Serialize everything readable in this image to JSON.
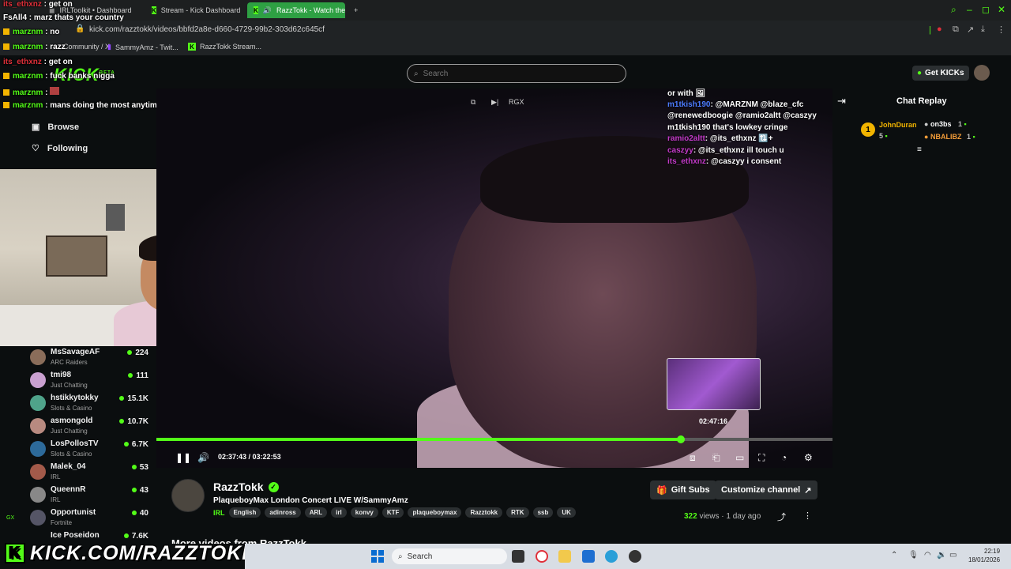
{
  "browser": {
    "tabs": [
      {
        "label": "IRLToolkit • Dashboard"
      },
      {
        "label": "Stream - Kick Dashboard"
      },
      {
        "label": "RazzTokk - Watch the"
      }
    ],
    "new_tab": "+",
    "url": "kick.com/razztokk/videos/bbfd2a8e-d660-4729-99b2-303d62c645cf",
    "bookmarks": [
      {
        "label": "Community / X"
      },
      {
        "label": "SammyAmz - Twit..."
      },
      {
        "label": "RazzTokk Stream..."
      }
    ]
  },
  "header": {
    "logo": "KICK",
    "logo_beta": "BETA",
    "search_placeholder": "Search",
    "get_kicks": "Get KICKs"
  },
  "nav": {
    "browse": "Browse",
    "following": "Following"
  },
  "overlay_chat": [
    {
      "user": "its_ethxnz",
      "sep": " : ",
      "msg": "get on",
      "color": "red"
    },
    {
      "user": "FsAll4",
      "sep": " : ",
      "msg": "marz thats your country",
      "color": "white"
    },
    {
      "user": "marznm",
      "sep": " : ",
      "msg": "no",
      "color": "green"
    },
    {
      "user": "marznm",
      "sep": " : ",
      "msg": "razz",
      "color": "green"
    },
    {
      "user": "its_ethxnz",
      "sep": " : ",
      "msg": "get on",
      "color": "red"
    },
    {
      "user": "marznm",
      "sep": " : ",
      "msg": "fuck banks nigga",
      "color": "green"
    },
    {
      "user": "marznm",
      "sep": " : ",
      "msg": "",
      "color": "green"
    },
    {
      "user": "marznm",
      "sep": " : ",
      "msg": "mans doing the most anytime that camera panned on you🤣🤣🤣",
      "color": "green"
    }
  ],
  "following_list": [
    {
      "name": "MsSavageAF",
      "category": "ARC Raiders",
      "viewers": "224"
    },
    {
      "name": "tmi98",
      "category": "Just Chatting",
      "viewers": "111"
    },
    {
      "name": "hstikkytokky",
      "category": "Slots & Casino",
      "viewers": "15.1K"
    },
    {
      "name": "asmongold",
      "category": "Just Chatting",
      "viewers": "10.7K"
    },
    {
      "name": "LosPollosTV",
      "category": "Slots & Casino",
      "viewers": "6.7K"
    },
    {
      "name": "Malek_04",
      "category": "IRL",
      "viewers": "53"
    },
    {
      "name": "QueennR",
      "category": "IRL",
      "viewers": "43"
    },
    {
      "name": "Opportunist",
      "category": "Fortnite",
      "viewers": "40"
    },
    {
      "name": "Ice Poseidon",
      "category": "",
      "viewers": "7.6K"
    }
  ],
  "video_chat": [
    {
      "user": "",
      "msg": "or with 🖼",
      "color": "n"
    },
    {
      "user": "m1tkish190",
      "msg": ": @MARZNM @blaze_cfc",
      "color": "b"
    },
    {
      "user": "",
      "msg": "@renewedboogie @ramio2altt @caszyy",
      "color": "n"
    },
    {
      "user": "",
      "msg": "m1tkish190 that's lowkey cringe",
      "color": "n"
    },
    {
      "user": "ramio2altt",
      "msg": ": @its_ethxnz 🔃+",
      "color": "p"
    },
    {
      "user": "caszyy",
      "msg": ": @its_ethxnz ill touch u",
      "color": "p"
    },
    {
      "user": "its_ethxnz",
      "msg": ": @caszyy i consent",
      "color": "p"
    }
  ],
  "video_top_label": "RGX",
  "thumb_time": "02:47:16",
  "player": {
    "current": "02:37:43",
    "duration": "03:22:53",
    "progress": 0.7752
  },
  "chat_replay": {
    "title": "Chat Replay",
    "rank": "1",
    "gifter_name": "JohnDuran",
    "gifter_count": "5",
    "recipients": [
      {
        "name": "on3bs",
        "count": "1"
      },
      {
        "name": "NBALIBZ",
        "count": "1"
      }
    ]
  },
  "channel": {
    "name": "RazzTokk",
    "title": "PlaqueboyMax London Concert LIVE W/SammyAmz",
    "category": "IRL",
    "tags": [
      "English",
      "adinross",
      "ARL",
      "irl",
      "konvy",
      "KTF",
      "plaqueboymax",
      "Razztokk",
      "RTK",
      "ssb",
      "UK"
    ],
    "gift_subs": "Gift Subs",
    "customize": "Customize channel",
    "views_count": "322",
    "views_label": "views",
    "ago": "1 day ago",
    "more_videos": "More videos from RazzTokk"
  },
  "brand_overlay": "KICK.COM/RAZZTOKK",
  "left_badge": "GX",
  "taskbar": {
    "search": "Search",
    "time": "22:19",
    "date": "18/01/2026"
  },
  "colors": {
    "accent": "#53fc18",
    "bg": "#0b0e0f"
  }
}
